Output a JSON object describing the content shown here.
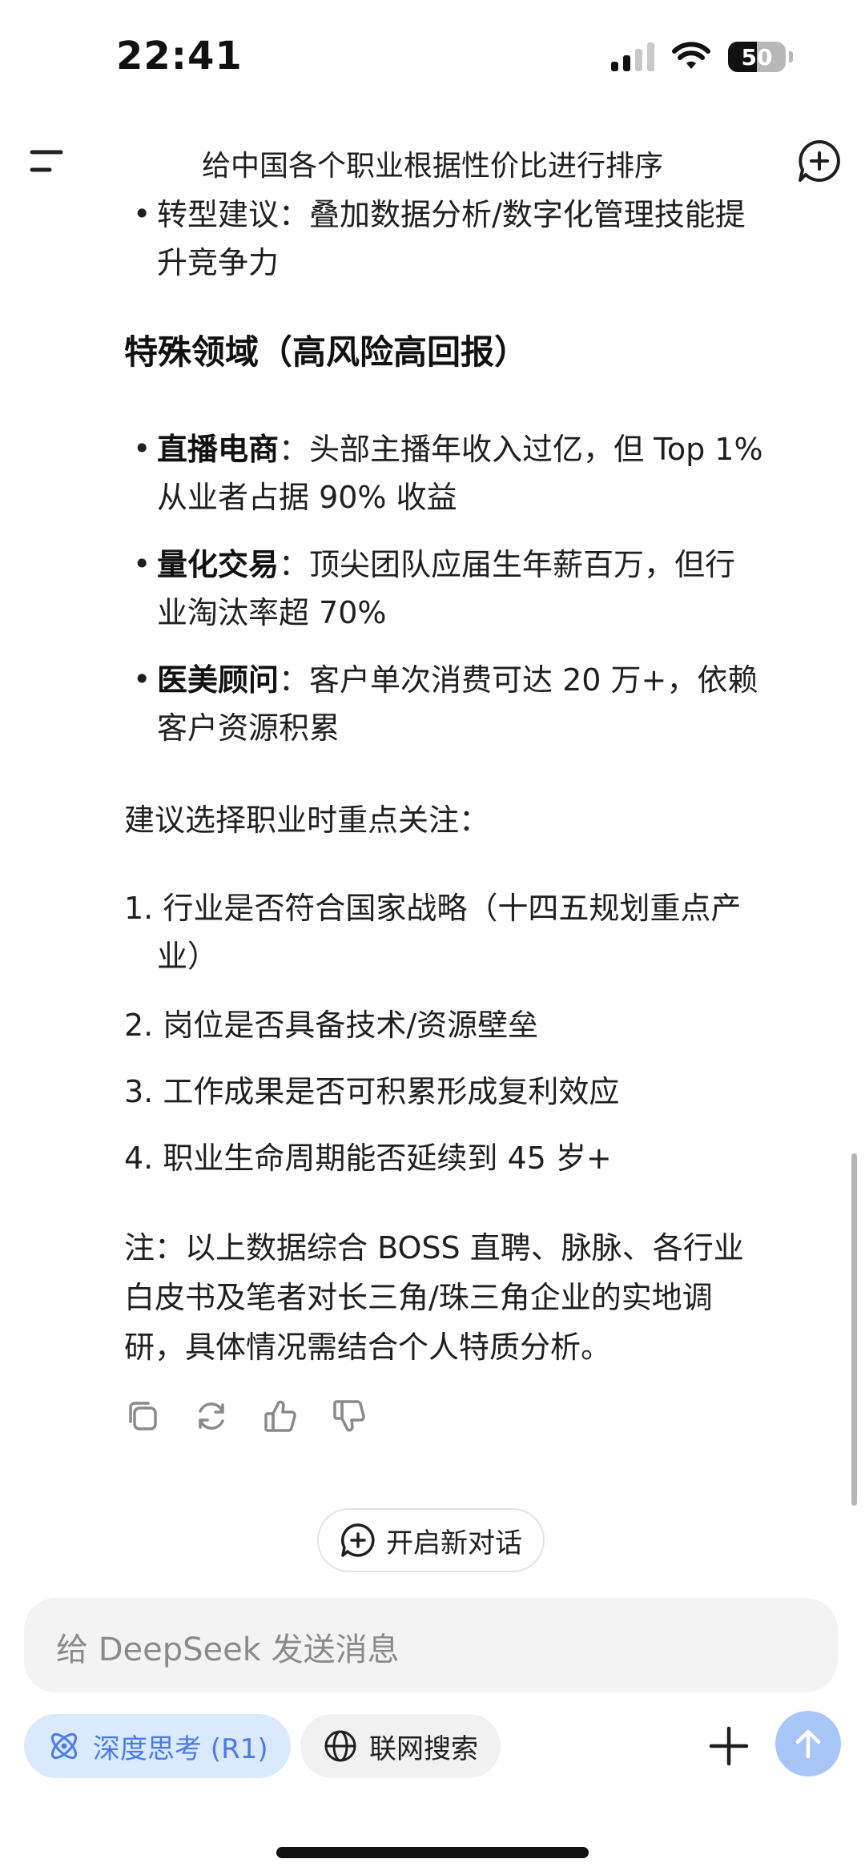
{
  "status_bar": {
    "time": "22:41",
    "battery": "50"
  },
  "header": {
    "title": "给中国各个职业根据性价比进行排序"
  },
  "content": {
    "prev_bullet_line1": "转型建议：叠加数据分析/数字化管理技能提",
    "prev_bullet_line2": "升竞争力",
    "special_heading": "特殊领域（高风险高回报）",
    "special_items": [
      {
        "term": "直播电商",
        "line1": "：头部主播年收入过亿，但 Top 1%",
        "line2": "从业者占据 90% 收益"
      },
      {
        "term": "量化交易",
        "line1": "：顶尖团队应届生年薪百万，但行",
        "line2": "业淘汰率超 70%"
      },
      {
        "term": "医美顾问",
        "line1": "：客户单次消费可达 20 万+，依赖",
        "line2": "客户资源积累"
      }
    ],
    "advice_intro": "建议选择职业时重点关注：",
    "numbered": [
      {
        "num": "1.",
        "line1": "行业是否符合国家战略（十四五规划重点产",
        "line2": "业）"
      },
      {
        "num": "2.",
        "line1": "岗位是否具备技术/资源壁垒"
      },
      {
        "num": "3.",
        "line1": "工作成果是否可积累形成复利效应"
      },
      {
        "num": "4.",
        "line1": "职业生命周期能否延续到 45 岁+"
      }
    ],
    "note_line1": "注：以上数据综合 BOSS 直聘、脉脉、各行业",
    "note_line2": "白皮书及笔者对长三角/珠三角企业的实地调",
    "note_line3": "研，具体情况需结合个人特质分析。"
  },
  "new_chat_button": "开启新对话",
  "input": {
    "placeholder": "给 DeepSeek 发送消息"
  },
  "toggles": {
    "deep_think": "深度思考 (R1)",
    "web_search": "联网搜索"
  },
  "colors": {
    "accent": "#4a7be8",
    "accent_bg": "#dbe9fe",
    "send_bg": "#a7c5f6"
  }
}
